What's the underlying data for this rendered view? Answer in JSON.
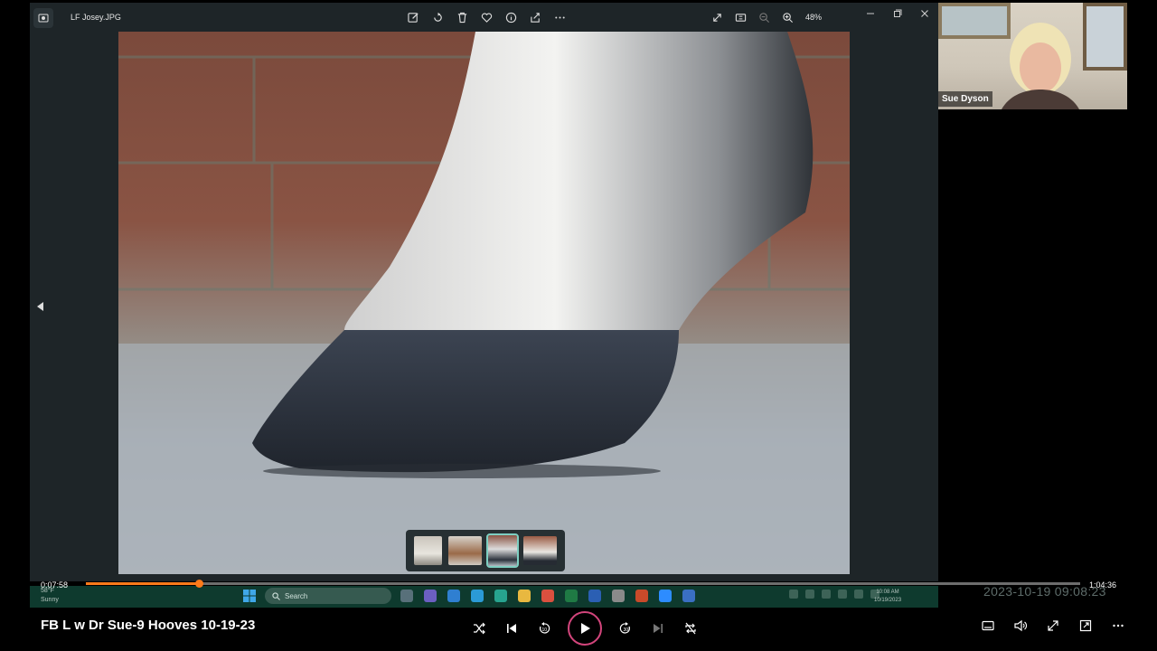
{
  "viewer": {
    "file_name": "LF Josey.JPG",
    "zoom": "48%"
  },
  "webcam": {
    "participant": "Sue Dyson"
  },
  "taskbar": {
    "weather_temp": "58°F",
    "weather_desc": "Sunny",
    "search_placeholder": "Search",
    "clock_time": "10:08 AM",
    "clock_date": "10/19/2023"
  },
  "recording_timestamp": "2023-10-19  09:08:23",
  "player": {
    "title": "FB L w Dr Sue-9 Hooves 10-19-23",
    "elapsed": "0:07:58",
    "total": "1:04:36",
    "progress_fraction": 0.1137
  },
  "colors": {
    "accent": "#ff7a1a",
    "play_ring": "#d3457c",
    "viewer_bg": "#1e2528",
    "filmstrip_selected": "#7ecfc2"
  },
  "icons": {
    "toolbar": [
      "edit-icon",
      "rotate-icon",
      "delete-icon",
      "favorite-icon",
      "info-icon",
      "share-icon",
      "more-icon"
    ],
    "view": [
      "fullscreen-icon",
      "slideshow-icon",
      "zoom-out-icon",
      "zoom-in-icon"
    ]
  }
}
